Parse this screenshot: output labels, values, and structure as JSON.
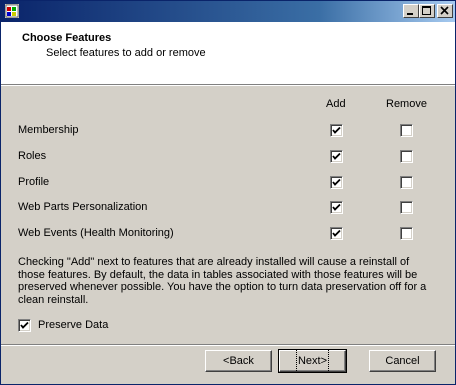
{
  "header": {
    "title": "Choose Features",
    "subtitle": "Select features to add or remove"
  },
  "columns": {
    "add": "Add",
    "remove": "Remove"
  },
  "features": [
    {
      "label": "Membership",
      "add": true,
      "remove": false
    },
    {
      "label": "Roles",
      "add": true,
      "remove": false
    },
    {
      "label": "Profile",
      "add": true,
      "remove": false
    },
    {
      "label": "Web Parts Personalization",
      "add": true,
      "remove": false
    },
    {
      "label": "Web Events (Health Monitoring)",
      "add": true,
      "remove": false
    }
  ],
  "note": "Checking \"Add\" next to features that are already installed will cause a reinstall of those features. By default, the data in tables associated with those features will be preserved whenever possible. You have the option to turn data preservation off for a clean reinstall.",
  "preserve": {
    "label": "Preserve Data",
    "checked": true
  },
  "buttons": {
    "back": "<Back",
    "next": "Next>",
    "cancel": "Cancel"
  }
}
